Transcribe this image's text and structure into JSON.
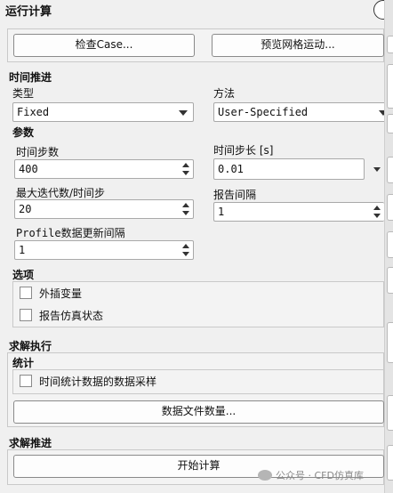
{
  "panel": {
    "title": "运行计算"
  },
  "top_buttons": {
    "check_case": "检查Case...",
    "preview_mesh": "预览网格运动..."
  },
  "time_advance": {
    "section": "时间推进",
    "type_label": "类型",
    "type_value": "Fixed",
    "method_label": "方法",
    "method_value": "User-Specified"
  },
  "params": {
    "section": "参数",
    "time_steps_label": "时间步数",
    "time_steps_value": "400",
    "step_size_label": "时间步长 [s]",
    "step_size_value": "0.01",
    "max_iter_label": "最大迭代数/时间步",
    "max_iter_value": "20",
    "report_interval_label": "报告间隔",
    "report_interval_value": "1",
    "profile_label": "Profile数据更新间隔",
    "profile_value": "1"
  },
  "options": {
    "section": "选项",
    "extrapolate": "外插变量",
    "report_status": "报告仿真状态"
  },
  "solve_exec": {
    "section": "求解执行",
    "stats_label": "统计",
    "sampling": "时间统计数据的数据采样",
    "data_files": "数据文件数量..."
  },
  "solve_advance": {
    "section": "求解推进",
    "start": "开始计算"
  },
  "watermark": {
    "text": "公众号 · CFD仿真库"
  }
}
